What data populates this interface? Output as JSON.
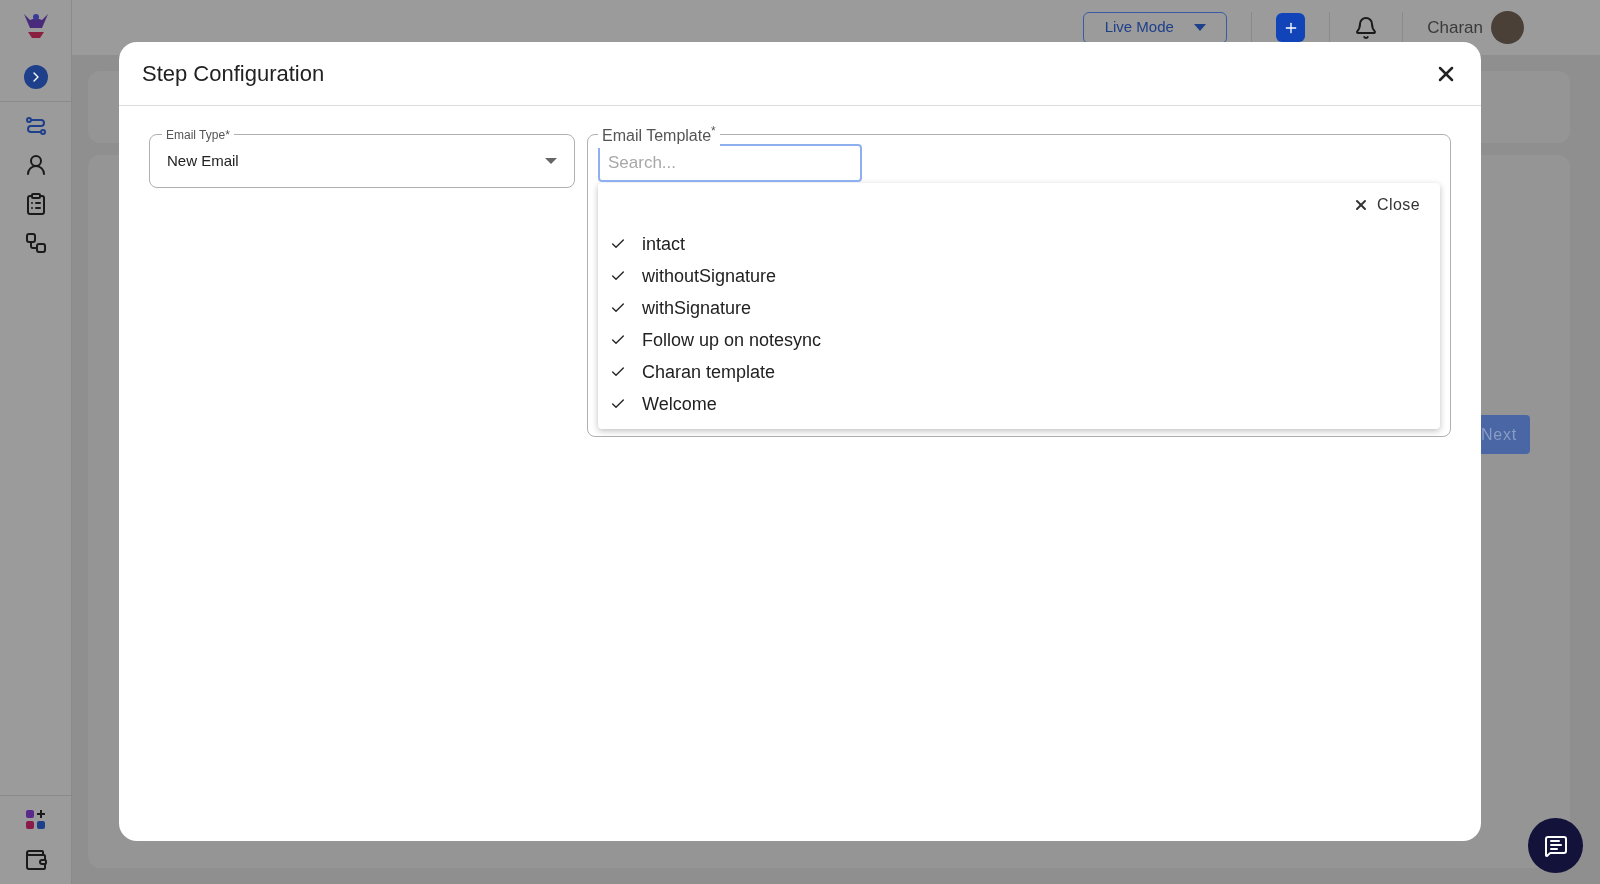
{
  "header": {
    "mode_button": "Live Mode",
    "user_name": "Charan"
  },
  "sidebar": {
    "items": [
      {
        "selected": true
      },
      {
        "selected": false
      },
      {
        "selected": false
      },
      {
        "selected": false
      }
    ]
  },
  "page": {
    "next_button": "Next"
  },
  "dialog": {
    "title": "Step Configuration",
    "email_type": {
      "label": "Email Type",
      "required_mark": "*",
      "value": "New Email"
    },
    "email_template": {
      "label": "Email Template",
      "required_mark": "*",
      "placeholder": "Search...",
      "close_label": "Close",
      "options": [
        {
          "label": "intact",
          "checked": true
        },
        {
          "label": "withoutSignature",
          "checked": true
        },
        {
          "label": "withSignature",
          "checked": true
        },
        {
          "label": "Follow up on notesync",
          "checked": true
        },
        {
          "label": "Charan template",
          "checked": true
        },
        {
          "label": "Welcome",
          "checked": true
        }
      ]
    }
  }
}
